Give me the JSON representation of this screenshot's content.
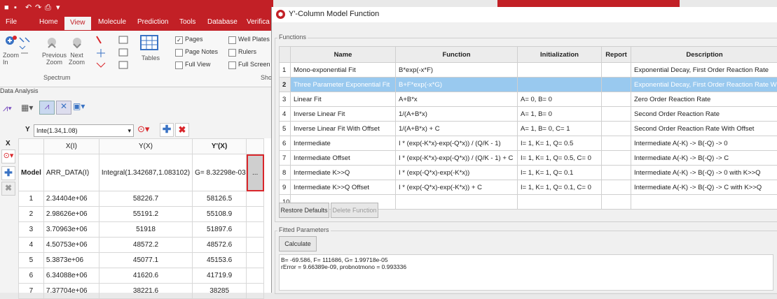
{
  "app": {
    "tabs": [
      "File",
      "Home",
      "View",
      "Molecule",
      "Prediction",
      "Tools",
      "Database",
      "Verifica"
    ],
    "active_tab": "View",
    "ribbon": {
      "zoom_in": "Zoom\nIn",
      "zoom_out": "Zoom\nOut",
      "previous_zoom": "Previous\nZoom",
      "next_zoom": "Next\nZoom",
      "spectrum_label": "Spectrum",
      "tables_label": "Tables",
      "pages": "Pages",
      "page_notes": "Page Notes",
      "full_view": "Full View",
      "well_plates": "Well Plates",
      "rulers": "Rulers",
      "full_screen": "Full Screen",
      "show_label": "Sho"
    },
    "panel_title": "Data Analysis",
    "selector_label": "Y",
    "selector_value": "Inte(1.34,1.08)",
    "grid": {
      "x_header": "X",
      "columns": [
        "X(I)",
        "Y(X)",
        "Y'(X)"
      ],
      "model_label": "Model",
      "model_row": [
        "ARR_DATA(I)",
        "Integral(1.342687,1.083102)",
        "G= 8.32298e-03"
      ],
      "ellipsis": "...",
      "rows": [
        [
          "1",
          "2.34404e+06",
          "58226.7",
          "58126.5"
        ],
        [
          "2",
          "2.98626e+06",
          "55191.2",
          "55108.9"
        ],
        [
          "3",
          "3.70963e+06",
          "51918",
          "51897.6"
        ],
        [
          "4",
          "4.50753e+06",
          "48572.2",
          "48572.6"
        ],
        [
          "5",
          "5.3873e+06",
          "45077.1",
          "45153.6"
        ],
        [
          "6",
          "6.34088e+06",
          "41620.6",
          "41719.9"
        ],
        [
          "7",
          "7.37704e+06",
          "38221.6",
          "38285"
        ]
      ]
    }
  },
  "dialog": {
    "title": "Y'-Column Model Function",
    "functions_label": "Functions",
    "headers": [
      "Name",
      "Function",
      "Initialization",
      "Report",
      "Description"
    ],
    "rows": [
      {
        "n": "1",
        "name": "Mono-exponential Fit",
        "func": "B*exp(-x*F)",
        "init": "",
        "report": "",
        "desc": "Exponential Decay, First Order Reaction Rate"
      },
      {
        "n": "2",
        "name": "Three Parameter Exponential Fit",
        "func": "B+F*exp(-x*G)",
        "init": "",
        "report": "",
        "desc": "Exponential Decay, First Order Reaction Rate With"
      },
      {
        "n": "3",
        "name": "Linear Fit",
        "func": "A+B*x",
        "init": "A= 0, B= 0",
        "report": "",
        "desc": "Zero Order Reaction Rate"
      },
      {
        "n": "4",
        "name": "Inverse Linear Fit",
        "func": "1/(A+B*x)",
        "init": "A= 1, B= 0",
        "report": "",
        "desc": "Second Order Reaction Rate"
      },
      {
        "n": "5",
        "name": "Inverse Linear Fit With Offset",
        "func": "1/(A+B*x) + C",
        "init": "A= 1, B= 0, C= 1",
        "report": "",
        "desc": "Second Order Reaction Rate With Offset"
      },
      {
        "n": "6",
        "name": "Intermediate",
        "func": "I * (exp(-K*x)-exp(-Q*x)) / (Q/K - 1)",
        "init": "I= 1, K= 1, Q= 0.5",
        "report": "",
        "desc": "Intermediate A(-K) -> B(-Q) -> 0"
      },
      {
        "n": "7",
        "name": "Intermediate Offset",
        "func": "I * (exp(-K*x)-exp(-Q*x)) / (Q/K - 1) + C",
        "init": "I= 1, K= 1, Q= 0.5, C= 0",
        "report": "",
        "desc": "Intermediate A(-K) -> B(-Q) -> C"
      },
      {
        "n": "8",
        "name": "Intermediate K>>Q",
        "func": "I * (exp(-Q*x)-exp(-K*x))",
        "init": "I= 1, K= 1, Q= 0.1",
        "report": "",
        "desc": "Intermediate A(-K) -> B(-Q) -> 0 with K>>Q"
      },
      {
        "n": "9",
        "name": "Intermediate K>>Q Offset",
        "func": "I * (exp(-Q*x)-exp(-K*x)) + C",
        "init": "I= 1, K= 1, Q= 0.1, C= 0",
        "report": "",
        "desc": "Intermediate A(-K) -> B(-Q) -> C with K>>Q"
      },
      {
        "n": "10",
        "name": "",
        "func": "",
        "init": "",
        "report": "",
        "desc": ""
      }
    ],
    "restore_defaults": "Restore Defaults",
    "delete_function": "Delete Function",
    "fitted_label": "Fitted Parameters",
    "calculate": "Calculate",
    "result_line1": "B= -69.586, F= 111686, G= 1.99718e-05",
    "result_line2": "rError = 9.66389e-09, probnotmono = 0.993336"
  },
  "colors": {
    "brand": "#c22026",
    "selection": "#99c9ef",
    "highlight_border": "#d9262b"
  }
}
